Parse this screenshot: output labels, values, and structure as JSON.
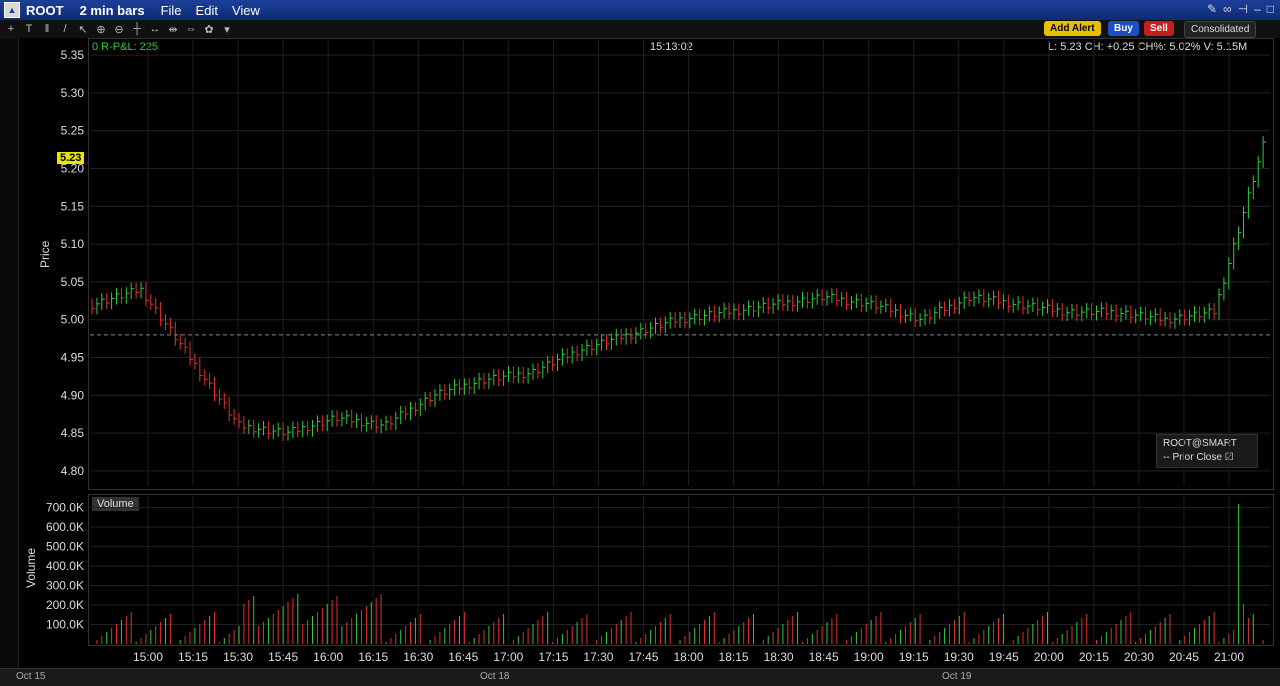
{
  "window": {
    "symbol": "ROOT",
    "bar_size": "2 min bars",
    "menus": [
      "File",
      "Edit",
      "View"
    ]
  },
  "toolbar": {
    "alert_label": "Add Alert",
    "buy_label": "Buy",
    "sell_label": "Sell",
    "feed_label": "Consolidated"
  },
  "price_panel": {
    "rpl": "0 R-P&L: 225",
    "time": "15:13:02",
    "quote": "L: 5.23 CH: +0.25 CH%: 5.02% V: 5.15M",
    "ylabel": "Price",
    "current_price": "5.23",
    "legend_symbol": "ROOT@SMART",
    "legend_prior": "Prior Close",
    "yticks": [
      "5.35",
      "5.30",
      "5.25",
      "5.20",
      "5.15",
      "5.10",
      "5.05",
      "5.00",
      "4.95",
      "4.90",
      "4.85",
      "4.80"
    ]
  },
  "volume_panel": {
    "title": "Volume",
    "ylabel": "Volume",
    "yticks": [
      "700.0K",
      "600.0K",
      "500.0K",
      "400.0K",
      "300.0K",
      "200.0K",
      "100.0K"
    ]
  },
  "xaxis": {
    "ticks": [
      "15:00",
      "15:15",
      "15:30",
      "15:45",
      "16:00",
      "16:15",
      "16:30",
      "16:45",
      "17:00",
      "17:15",
      "17:30",
      "17:45",
      "18:00",
      "18:15",
      "18:30",
      "18:45",
      "19:00",
      "19:15",
      "19:30",
      "19:45",
      "20:00",
      "20:15",
      "20:30",
      "20:45",
      "21:00"
    ]
  },
  "scroll": {
    "dates": [
      "Oct 15",
      "Oct 18",
      "Oct 19"
    ]
  },
  "colors": {
    "up": "#2ecc40",
    "down": "#e03030",
    "unchanged": "#ffffff",
    "grid": "#333333"
  },
  "chart_data": {
    "type": "line",
    "title": "",
    "ylim": [
      4.78,
      5.37
    ],
    "prior_close": 4.98,
    "series": [
      {
        "name": "ROOT@SMART",
        "x": [
          "15:00",
          "15:15",
          "15:30",
          "15:45",
          "16:00",
          "16:15",
          "16:30",
          "16:45",
          "17:00",
          "17:15",
          "17:30",
          "17:45",
          "18:00",
          "18:15",
          "18:30",
          "18:45",
          "19:00",
          "19:15",
          "19:30",
          "19:45",
          "20:00",
          "20:15",
          "20:30",
          "20:45",
          "21:00"
        ],
        "values": [
          5.02,
          5.04,
          4.95,
          4.86,
          4.85,
          4.87,
          4.86,
          4.9,
          4.92,
          4.93,
          4.96,
          4.98,
          5.0,
          5.01,
          5.02,
          5.03,
          5.02,
          5.0,
          5.03,
          5.02,
          5.01,
          5.01,
          5.0,
          5.01,
          5.23
        ]
      }
    ]
  }
}
